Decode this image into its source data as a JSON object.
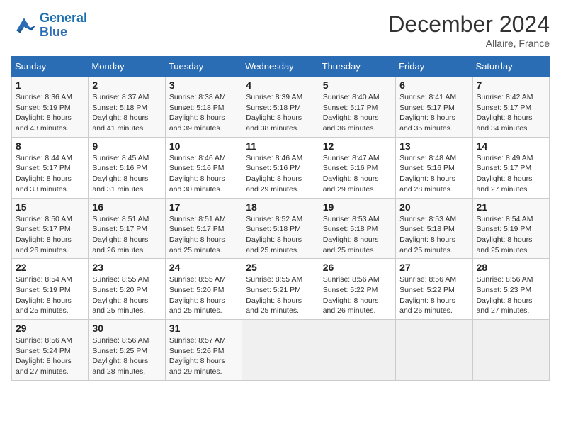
{
  "header": {
    "logo_line1": "General",
    "logo_line2": "Blue",
    "month": "December 2024",
    "location": "Allaire, France"
  },
  "weekdays": [
    "Sunday",
    "Monday",
    "Tuesday",
    "Wednesday",
    "Thursday",
    "Friday",
    "Saturday"
  ],
  "weeks": [
    [
      {
        "day": "1",
        "sunrise": "Sunrise: 8:36 AM",
        "sunset": "Sunset: 5:19 PM",
        "daylight": "Daylight: 8 hours and 43 minutes."
      },
      {
        "day": "2",
        "sunrise": "Sunrise: 8:37 AM",
        "sunset": "Sunset: 5:18 PM",
        "daylight": "Daylight: 8 hours and 41 minutes."
      },
      {
        "day": "3",
        "sunrise": "Sunrise: 8:38 AM",
        "sunset": "Sunset: 5:18 PM",
        "daylight": "Daylight: 8 hours and 39 minutes."
      },
      {
        "day": "4",
        "sunrise": "Sunrise: 8:39 AM",
        "sunset": "Sunset: 5:18 PM",
        "daylight": "Daylight: 8 hours and 38 minutes."
      },
      {
        "day": "5",
        "sunrise": "Sunrise: 8:40 AM",
        "sunset": "Sunset: 5:17 PM",
        "daylight": "Daylight: 8 hours and 36 minutes."
      },
      {
        "day": "6",
        "sunrise": "Sunrise: 8:41 AM",
        "sunset": "Sunset: 5:17 PM",
        "daylight": "Daylight: 8 hours and 35 minutes."
      },
      {
        "day": "7",
        "sunrise": "Sunrise: 8:42 AM",
        "sunset": "Sunset: 5:17 PM",
        "daylight": "Daylight: 8 hours and 34 minutes."
      }
    ],
    [
      {
        "day": "8",
        "sunrise": "Sunrise: 8:44 AM",
        "sunset": "Sunset: 5:17 PM",
        "daylight": "Daylight: 8 hours and 33 minutes."
      },
      {
        "day": "9",
        "sunrise": "Sunrise: 8:45 AM",
        "sunset": "Sunset: 5:16 PM",
        "daylight": "Daylight: 8 hours and 31 minutes."
      },
      {
        "day": "10",
        "sunrise": "Sunrise: 8:46 AM",
        "sunset": "Sunset: 5:16 PM",
        "daylight": "Daylight: 8 hours and 30 minutes."
      },
      {
        "day": "11",
        "sunrise": "Sunrise: 8:46 AM",
        "sunset": "Sunset: 5:16 PM",
        "daylight": "Daylight: 8 hours and 29 minutes."
      },
      {
        "day": "12",
        "sunrise": "Sunrise: 8:47 AM",
        "sunset": "Sunset: 5:16 PM",
        "daylight": "Daylight: 8 hours and 29 minutes."
      },
      {
        "day": "13",
        "sunrise": "Sunrise: 8:48 AM",
        "sunset": "Sunset: 5:16 PM",
        "daylight": "Daylight: 8 hours and 28 minutes."
      },
      {
        "day": "14",
        "sunrise": "Sunrise: 8:49 AM",
        "sunset": "Sunset: 5:17 PM",
        "daylight": "Daylight: 8 hours and 27 minutes."
      }
    ],
    [
      {
        "day": "15",
        "sunrise": "Sunrise: 8:50 AM",
        "sunset": "Sunset: 5:17 PM",
        "daylight": "Daylight: 8 hours and 26 minutes."
      },
      {
        "day": "16",
        "sunrise": "Sunrise: 8:51 AM",
        "sunset": "Sunset: 5:17 PM",
        "daylight": "Daylight: 8 hours and 26 minutes."
      },
      {
        "day": "17",
        "sunrise": "Sunrise: 8:51 AM",
        "sunset": "Sunset: 5:17 PM",
        "daylight": "Daylight: 8 hours and 25 minutes."
      },
      {
        "day": "18",
        "sunrise": "Sunrise: 8:52 AM",
        "sunset": "Sunset: 5:18 PM",
        "daylight": "Daylight: 8 hours and 25 minutes."
      },
      {
        "day": "19",
        "sunrise": "Sunrise: 8:53 AM",
        "sunset": "Sunset: 5:18 PM",
        "daylight": "Daylight: 8 hours and 25 minutes."
      },
      {
        "day": "20",
        "sunrise": "Sunrise: 8:53 AM",
        "sunset": "Sunset: 5:18 PM",
        "daylight": "Daylight: 8 hours and 25 minutes."
      },
      {
        "day": "21",
        "sunrise": "Sunrise: 8:54 AM",
        "sunset": "Sunset: 5:19 PM",
        "daylight": "Daylight: 8 hours and 25 minutes."
      }
    ],
    [
      {
        "day": "22",
        "sunrise": "Sunrise: 8:54 AM",
        "sunset": "Sunset: 5:19 PM",
        "daylight": "Daylight: 8 hours and 25 minutes."
      },
      {
        "day": "23",
        "sunrise": "Sunrise: 8:55 AM",
        "sunset": "Sunset: 5:20 PM",
        "daylight": "Daylight: 8 hours and 25 minutes."
      },
      {
        "day": "24",
        "sunrise": "Sunrise: 8:55 AM",
        "sunset": "Sunset: 5:20 PM",
        "daylight": "Daylight: 8 hours and 25 minutes."
      },
      {
        "day": "25",
        "sunrise": "Sunrise: 8:55 AM",
        "sunset": "Sunset: 5:21 PM",
        "daylight": "Daylight: 8 hours and 25 minutes."
      },
      {
        "day": "26",
        "sunrise": "Sunrise: 8:56 AM",
        "sunset": "Sunset: 5:22 PM",
        "daylight": "Daylight: 8 hours and 26 minutes."
      },
      {
        "day": "27",
        "sunrise": "Sunrise: 8:56 AM",
        "sunset": "Sunset: 5:22 PM",
        "daylight": "Daylight: 8 hours and 26 minutes."
      },
      {
        "day": "28",
        "sunrise": "Sunrise: 8:56 AM",
        "sunset": "Sunset: 5:23 PM",
        "daylight": "Daylight: 8 hours and 27 minutes."
      }
    ],
    [
      {
        "day": "29",
        "sunrise": "Sunrise: 8:56 AM",
        "sunset": "Sunset: 5:24 PM",
        "daylight": "Daylight: 8 hours and 27 minutes."
      },
      {
        "day": "30",
        "sunrise": "Sunrise: 8:56 AM",
        "sunset": "Sunset: 5:25 PM",
        "daylight": "Daylight: 8 hours and 28 minutes."
      },
      {
        "day": "31",
        "sunrise": "Sunrise: 8:57 AM",
        "sunset": "Sunset: 5:26 PM",
        "daylight": "Daylight: 8 hours and 29 minutes."
      },
      null,
      null,
      null,
      null
    ]
  ]
}
